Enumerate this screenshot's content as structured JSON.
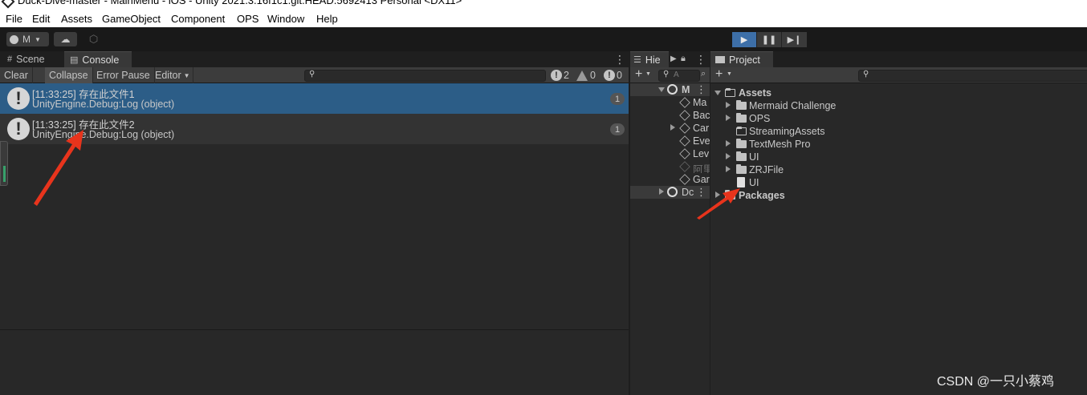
{
  "window": {
    "title": "Duck-Dive-master - MainMenu - iOS - Unity 2021.3.16f1c1.git.HEAD.5692413 Personal <DX11>"
  },
  "menu": [
    "File",
    "Edit",
    "Assets",
    "GameObject",
    "Component",
    "OPS",
    "Window",
    "Help"
  ],
  "toolbar": {
    "account_label": "M",
    "account_icon": "account-icon",
    "cloud_icon": "cloud-icon",
    "collab_icon": "collab-icon"
  },
  "play_controls": {
    "play_icon": "play-icon",
    "pause_icon": "pause-icon",
    "step_icon": "step-icon",
    "play_color": "#3d6fa8"
  },
  "tabs": {
    "scene": "Scene",
    "console": "Console",
    "hierarchy": "Hie",
    "project": "Project"
  },
  "console": {
    "clear": "Clear",
    "collapse": "Collapse",
    "error_pause": "Error Pause",
    "editor": "Editor",
    "count_log": "2",
    "count_warn": "0",
    "count_error": "0",
    "entries": [
      {
        "line1": "[11:33:25] 存在此文件1",
        "line2": "UnityEngine.Debug:Log (object)",
        "count": "1"
      },
      {
        "line1": "[11:33:25] 存在此文件2",
        "line2": "UnityEngine.Debug:Log (object)",
        "count": "1"
      }
    ],
    "selected_color": "#2c5d87"
  },
  "hierarchy": {
    "search_placeholder": "A",
    "scene_name": "M",
    "items": [
      "Ma",
      "Bac",
      "Car",
      "Eve",
      "Lev",
      "阿里",
      "Gar"
    ],
    "second_scene": "Dc"
  },
  "project": {
    "root": "Assets",
    "folders": [
      "Mermaid Challenge",
      "OPS",
      "StreamingAssets",
      "TextMesh Pro",
      "UI",
      "ZRJFile"
    ],
    "file": "UI",
    "packages": "Packages"
  },
  "watermark": "CSDN @一只小蔡鸡",
  "accent_red": "#e8341c"
}
